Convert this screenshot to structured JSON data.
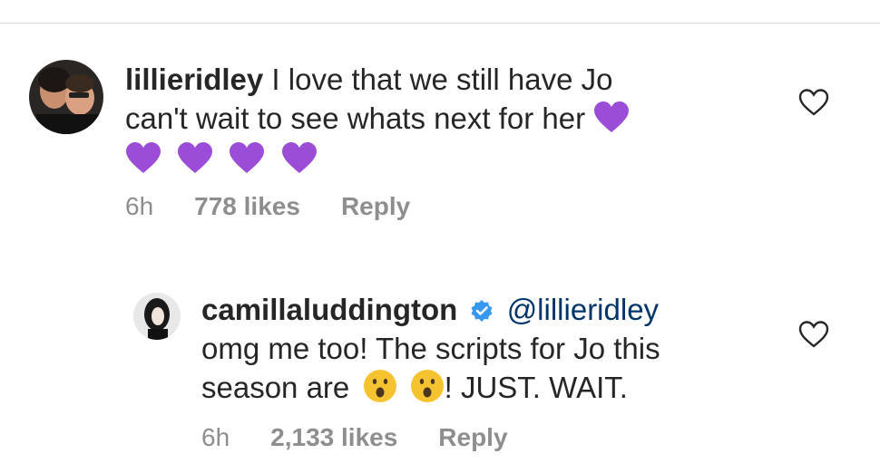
{
  "comments": [
    {
      "username": "lillieridley",
      "text_line1": "I love that we still have Jo",
      "text_line2": "can't wait to see whats next for her",
      "time": "6h",
      "likes": "778 likes",
      "reply": "Reply",
      "emoji_name": "purple-heart"
    },
    {
      "username": "camillaluddington",
      "mention": "@lillieridley",
      "text_line1": "omg me too! The scripts for Jo this",
      "text_line2_pre": "season are",
      "text_line2_post": "! JUST. WAIT.",
      "time": "6h",
      "likes": "2,133 likes",
      "reply": "Reply",
      "emoji_name": "hushed-face",
      "verified": true
    }
  ],
  "colors": {
    "heart_purple": "#9b4dd8",
    "verified_blue": "#3897f0",
    "mention": "#003569",
    "meta_gray": "#8e8e8e",
    "emoji_yellow": "#f6c330"
  },
  "icons": {
    "like": "heart-outline-icon",
    "verified": "verified-badge-icon"
  }
}
